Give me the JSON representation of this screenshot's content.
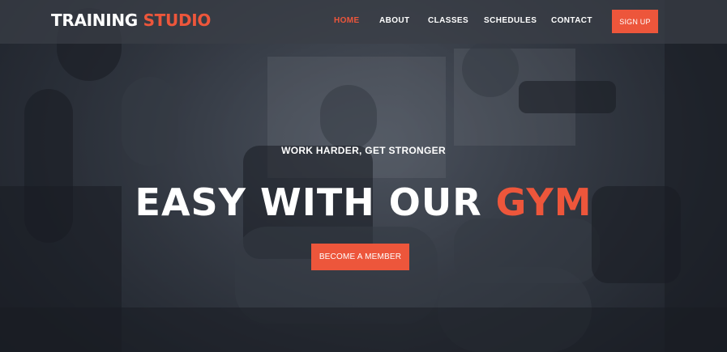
{
  "brand": {
    "name_part1": "TRAINING",
    "name_part2": "STUDIO",
    "accent_color": "#ed563b"
  },
  "nav": {
    "items": [
      {
        "label": "HOME",
        "active": true
      },
      {
        "label": "ABOUT",
        "active": false
      },
      {
        "label": "CLASSES",
        "active": false
      },
      {
        "label": "SCHEDULES",
        "active": false
      },
      {
        "label": "CONTACT",
        "active": false
      }
    ],
    "signup_label": "SIGN UP"
  },
  "hero": {
    "subtitle": "WORK HARDER, GET STRONGER",
    "headline_part1": "EASY WITH OUR",
    "headline_part2": "GYM",
    "cta_label": "BECOME A MEMBER"
  }
}
